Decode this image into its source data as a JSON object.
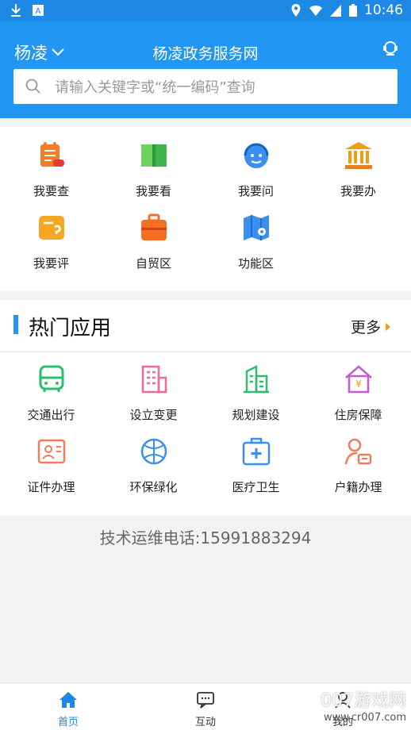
{
  "status": {
    "time": "10:46"
  },
  "header": {
    "city": "杨凌",
    "title": "杨凌政务服务网",
    "search_placeholder": "请输入关键字或“统一编码”查询"
  },
  "quick": [
    {
      "label": "我要查",
      "icon": "search-record-icon",
      "color": "#f57c28"
    },
    {
      "label": "我要看",
      "icon": "book-icon",
      "color": "#5cc35a"
    },
    {
      "label": "我要问",
      "icon": "headset-icon",
      "color": "#3b8ff0"
    },
    {
      "label": "我要办",
      "icon": "building-icon",
      "color": "#f39c12"
    },
    {
      "label": "我要评",
      "icon": "comment-icon",
      "color": "#f5a623"
    },
    {
      "label": "自贸区",
      "icon": "briefcase-icon",
      "color": "#f36f21"
    },
    {
      "label": "功能区",
      "icon": "map-icon",
      "color": "#3b8ff0"
    }
  ],
  "hot": {
    "title": "热门应用",
    "more": "更多",
    "items": [
      {
        "label": "交通出行",
        "icon": "bus-icon",
        "color": "#2dbd6e"
      },
      {
        "label": "设立变更",
        "icon": "office-building-icon",
        "color": "#f06c8e"
      },
      {
        "label": "规划建设",
        "icon": "buildings-icon",
        "color": "#2dbd6e"
      },
      {
        "label": "住房保障",
        "icon": "house-icon",
        "color": "#c35bd8"
      },
      {
        "label": "证件办理",
        "icon": "id-card-icon",
        "color": "#f07a5a"
      },
      {
        "label": "环保绿化",
        "icon": "leaf-icon",
        "color": "#3b8ff0"
      },
      {
        "label": "医疗卫生",
        "icon": "medical-kit-icon",
        "color": "#3b8ff0"
      },
      {
        "label": "户籍办理",
        "icon": "person-card-icon",
        "color": "#f07a5a"
      }
    ]
  },
  "footer": {
    "support": "技术运维电话:15991883294"
  },
  "tabs": [
    {
      "label": "首页",
      "icon": "home-icon"
    },
    {
      "label": "互动",
      "icon": "chat-icon"
    },
    {
      "label": "我的",
      "icon": "user-icon"
    }
  ],
  "watermark": {
    "line1": "007游戏网",
    "line2": "www.cr007.com"
  }
}
